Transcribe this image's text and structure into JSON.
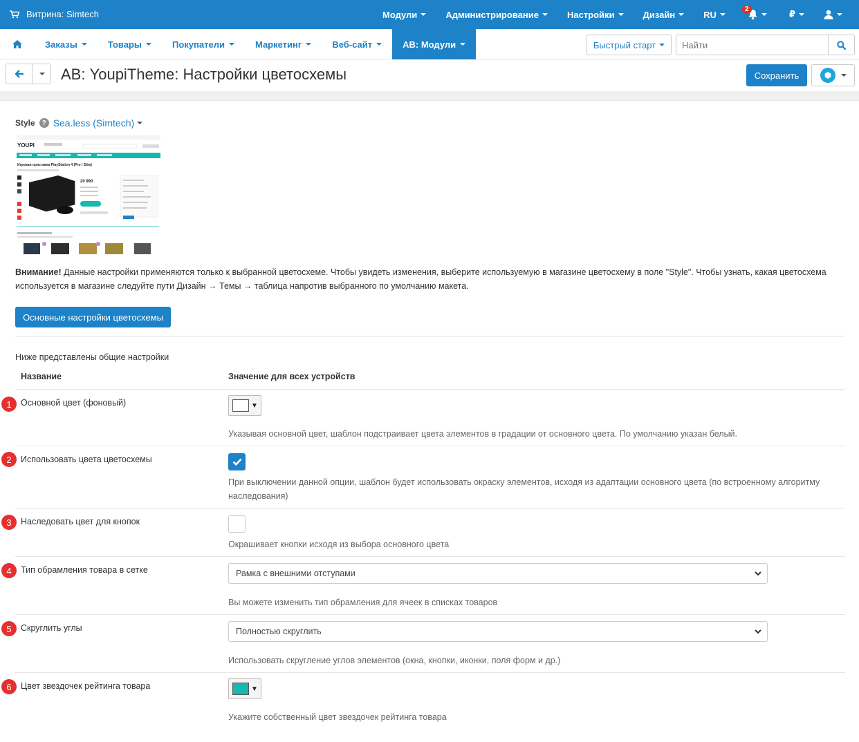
{
  "topbar": {
    "store_label": "Витрина: Simtech",
    "menu": [
      {
        "label": "Модули"
      },
      {
        "label": "Администрирование"
      },
      {
        "label": "Настройки"
      },
      {
        "label": "Дизайн"
      },
      {
        "label": "RU"
      }
    ],
    "notifications_count": "2",
    "currency": "₽"
  },
  "navbar": {
    "items": [
      {
        "label": "Заказы"
      },
      {
        "label": "Товары"
      },
      {
        "label": "Покупатели"
      },
      {
        "label": "Маркетинг"
      },
      {
        "label": "Веб-сайт"
      },
      {
        "label": "АВ: Модули"
      }
    ],
    "quick_start": "Быстрый старт",
    "search_placeholder": "Найти"
  },
  "title": {
    "text": "АВ: YoupiTheme: Настройки цветосхемы",
    "save": "Сохранить"
  },
  "style": {
    "label": "Style",
    "value": "Sea.less (Simtech)"
  },
  "preview": {
    "logo": "YOUPI",
    "product_title": "Игровая приставка PlayStation 4 (Pro / Slim)",
    "price": "20 990"
  },
  "warning": {
    "bold": "Внимание!",
    "text": " Данные настройки применяются только к выбранной цветосхеме. Чтобы увидеть изменения, выберите используемую в магазине цветосхему в поле \"Style\". Чтобы узнать, какая цветосхема используется в магазине следуйте пути Дизайн → Темы → таблица напротив выбранного по умолчанию макета."
  },
  "main_button": "Основные настройки цветосхемы",
  "intro": "Ниже представлены общие настройки",
  "columns": {
    "name": "Название",
    "value": "Значение для всех устройств"
  },
  "settings": [
    {
      "num": "1",
      "label": "Основной цвет (фоновый)",
      "type": "color",
      "color": "#ffffff",
      "help": "Указывая основной цвет, шаблон подстраивает цвета элементов в градации от основного цвета. По умолчанию указан белый."
    },
    {
      "num": "2",
      "label": "Использовать цвета цветосхемы",
      "type": "checkbox",
      "checked": true,
      "help": "При выключении данной опции, шаблон будет использовать окраску элементов, исходя из адаптации основного цвета (по встроенному алгоритму наследования)"
    },
    {
      "num": "3",
      "label": "Наследовать цвет для кнопок",
      "type": "checkbox",
      "checked": false,
      "help": "Окрашивает кнопки исходя из выбора основного цвета"
    },
    {
      "num": "4",
      "label": "Тип обрамления товара в сетке",
      "type": "select",
      "value": "Рамка с внешними отступами",
      "help": "Вы можете изменить тип обрамления для ячеек в списках товаров"
    },
    {
      "num": "5",
      "label": "Скруглить углы",
      "type": "select",
      "value": "Полностью скруглить",
      "help": "Использовать скругление углов элементов (окна, кнопки, иконки, поля форм и др.)"
    },
    {
      "num": "6",
      "label": "Цвет звездочек рейтинга товара",
      "type": "color",
      "color": "#17b8b0",
      "help": "Укажите собственный цвет звездочек рейтинга товара"
    }
  ],
  "colors": {
    "accent": "#1d82c7",
    "marker": "#e63030"
  }
}
